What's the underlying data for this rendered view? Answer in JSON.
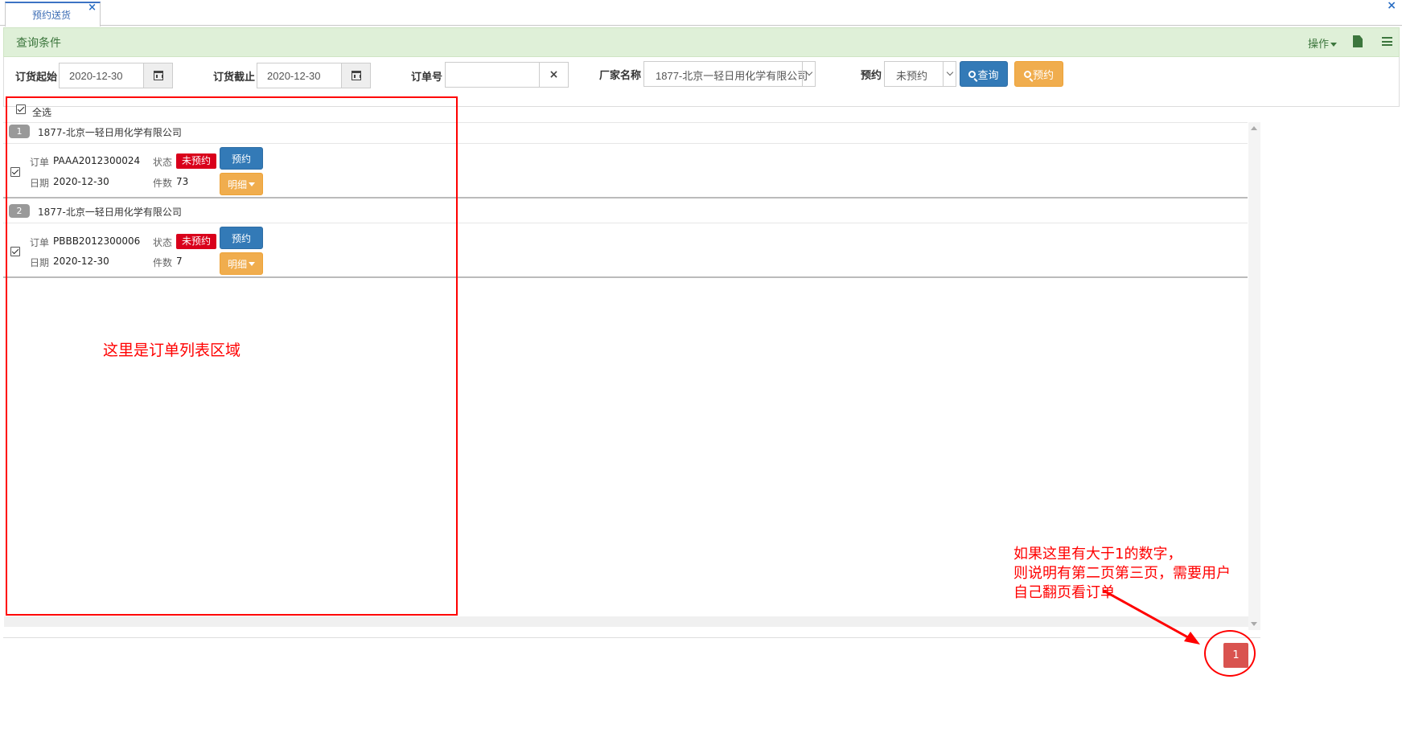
{
  "tab": {
    "label": "预约送货",
    "close": "×"
  },
  "window_close": "×",
  "query_header": {
    "title": "查询条件",
    "ops_label": "操作"
  },
  "filters": {
    "start_label": "订货起始",
    "start_value": "2020-12-30",
    "end_label": "订货截止",
    "end_value": "2020-12-30",
    "order_label": "订单号",
    "order_value": "",
    "clear": "×",
    "vendor_label": "厂家名称",
    "vendor_value": "1877-北京一轻日用化学有限公司",
    "reserve_label": "预约",
    "reserve_value": "未预约",
    "query_button": "查询",
    "reserve_button": "预约"
  },
  "list": {
    "select_all": "全选",
    "groups": [
      {
        "index": "1",
        "vendor": "1877-北京一轻日用化学有限公司",
        "order_label": "订单",
        "order_no": "PAAA2012300024",
        "status_label": "状态",
        "status": "未预约",
        "date_label": "日期",
        "date": "2020-12-30",
        "count_label": "件数",
        "count": "73",
        "reserve_btn": "预约",
        "detail_btn": "明细"
      },
      {
        "index": "2",
        "vendor": "1877-北京一轻日用化学有限公司",
        "order_label": "订单",
        "order_no": "PBBB2012300006",
        "status_label": "状态",
        "status": "未预约",
        "date_label": "日期",
        "date": "2020-12-30",
        "count_label": "件数",
        "count": "7",
        "reserve_btn": "预约",
        "detail_btn": "明细"
      }
    ]
  },
  "annotations": {
    "list_area": "这里是订单列表区域",
    "pager_note_1": "如果这里有大于1的数字，",
    "pager_note_2": "则说明有第二页第三页，需要用户",
    "pager_note_3": "自己翻页看订单"
  },
  "pager": {
    "current": "1"
  },
  "colors": {
    "primary": "#337ab7",
    "warning": "#f0ad4e",
    "danger": "#d9001b",
    "header_bg": "#dff0d8",
    "annotation": "#ff0000"
  }
}
